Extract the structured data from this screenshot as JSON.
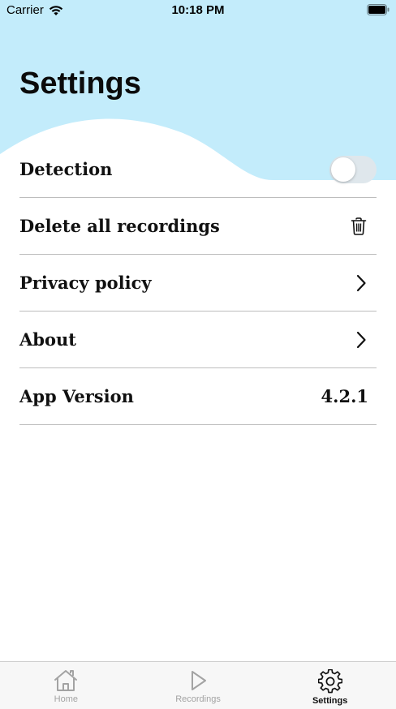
{
  "status_bar": {
    "carrier": "Carrier",
    "time": "10:18 PM"
  },
  "header": {
    "title": "Settings",
    "wave_color": "#c3ecfb"
  },
  "settings": {
    "detection": {
      "label": "Detection",
      "toggle_on": false
    },
    "delete_all": {
      "label": "Delete all recordings",
      "icon": "trash-icon"
    },
    "privacy": {
      "label": "Privacy policy",
      "icon": "chevron-right-icon"
    },
    "about": {
      "label": "About",
      "icon": "chevron-right-icon"
    },
    "app_version": {
      "label": "App Version",
      "value": "4.2.1"
    }
  },
  "tab_bar": {
    "home": {
      "label": "Home",
      "icon": "home-icon"
    },
    "recordings": {
      "label": "Recordings",
      "icon": "play-icon"
    },
    "settings": {
      "label": "Settings",
      "icon": "gear-icon",
      "active": true
    }
  }
}
